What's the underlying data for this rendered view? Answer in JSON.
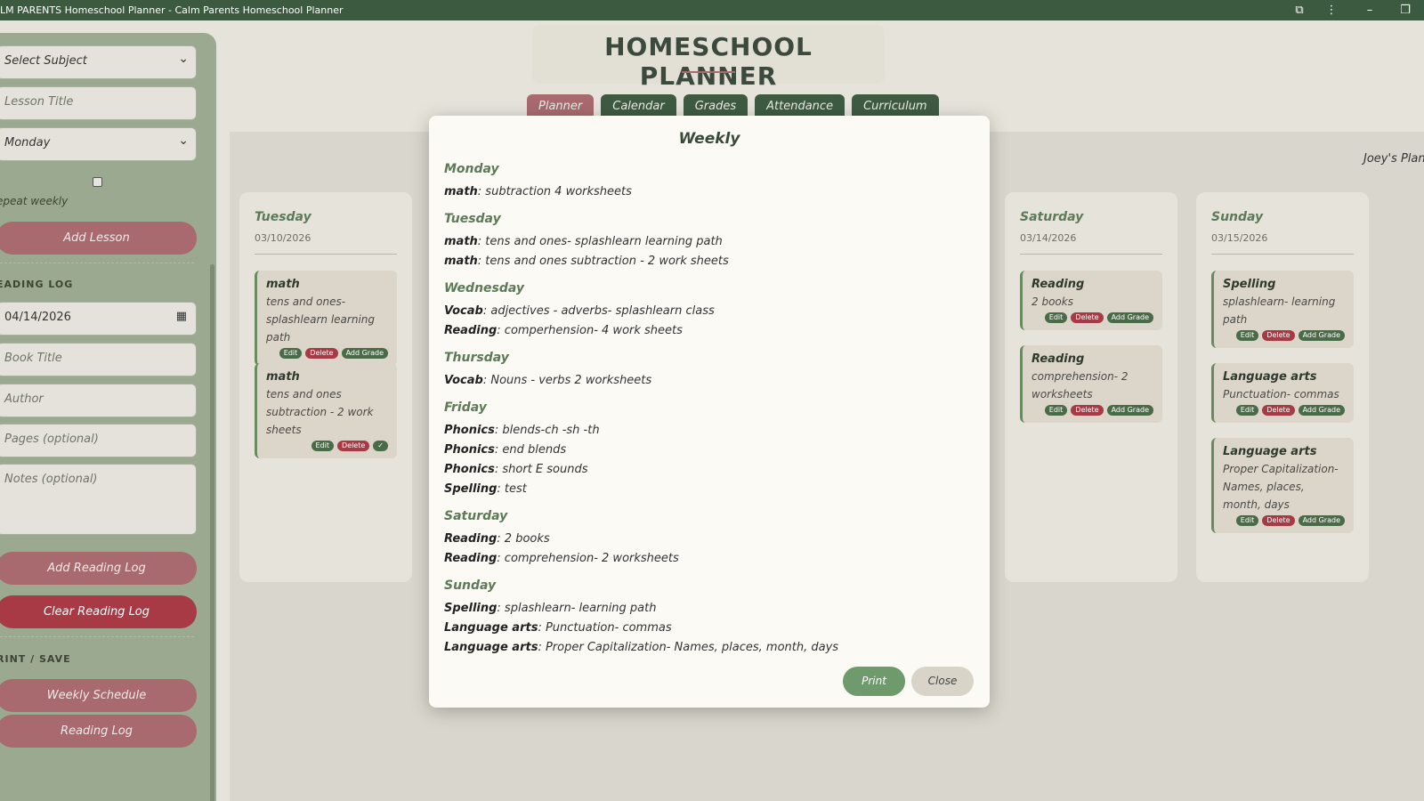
{
  "window": {
    "title": "LM PARENTS Homeschool Planner - Calm Parents Homeschool Planner"
  },
  "sidebar": {
    "subject_select": "Select Subject",
    "lesson_title_placeholder": "Lesson Title",
    "day_select": "Monday",
    "repeat_label": "epeat weekly",
    "add_lesson": "Add Lesson",
    "reading_log_heading": "EADING LOG",
    "reading_date": "04/14/2026",
    "book_title_placeholder": "Book Title",
    "author_placeholder": "Author",
    "pages_placeholder": "Pages (optional)",
    "notes_placeholder": "Notes (optional)",
    "add_reading_log": "Add Reading Log",
    "clear_reading_log": "Clear Reading Log",
    "print_heading": "RINT / SAVE",
    "weekly_schedule": "Weekly Schedule",
    "reading_log": "Reading Log"
  },
  "header": {
    "title": "HOMESCHOOL PLANNER",
    "tabs": [
      "Planner",
      "Calendar",
      "Grades",
      "Attendance",
      "Curriculum"
    ],
    "active_tab": "Planner",
    "planner_name": "Joey's Plann"
  },
  "days": [
    {
      "name": "Tuesday",
      "date": "03/10/2026",
      "lessons": [
        {
          "subject": "math",
          "text": "tens and ones- splashlearn learning path",
          "buttons": [
            "Edit",
            "Delete",
            "Add Grade"
          ]
        },
        {
          "subject": "math",
          "text": "tens and ones subtraction - 2 work sheets",
          "buttons": [
            "Edit",
            "Delete",
            "✓"
          ]
        }
      ]
    },
    {
      "name": "Saturday",
      "date": "03/14/2026",
      "lessons": [
        {
          "subject": "Reading",
          "text": "2 books",
          "buttons": [
            "Edit",
            "Delete",
            "Add Grade"
          ]
        },
        {
          "subject": "Reading",
          "text": "comprehension- 2 worksheets",
          "buttons": [
            "Edit",
            "Delete",
            "Add Grade"
          ]
        }
      ]
    },
    {
      "name": "Sunday",
      "date": "03/15/2026",
      "lessons": [
        {
          "subject": "Spelling",
          "text": "splashlearn- learning path",
          "buttons": [
            "Edit",
            "Delete",
            "Add Grade"
          ]
        },
        {
          "subject": "Language arts",
          "text": "Punctuation- commas",
          "buttons": [
            "Edit",
            "Delete",
            "Add Grade"
          ]
        },
        {
          "subject": "Language arts",
          "text": "Proper Capitalization- Names, places, month, days",
          "buttons": [
            "Edit",
            "Delete",
            "Add Grade"
          ]
        }
      ]
    }
  ],
  "modal": {
    "title": "Weekly",
    "days": [
      {
        "day": "Monday",
        "items": [
          {
            "subject": "math",
            "text": ": subtraction 4 worksheets"
          }
        ]
      },
      {
        "day": "Tuesday",
        "items": [
          {
            "subject": "math",
            "text": ": tens and ones- splashlearn learning path"
          },
          {
            "subject": "math",
            "text": ": tens and ones subtraction - 2 work sheets"
          }
        ]
      },
      {
        "day": "Wednesday",
        "items": [
          {
            "subject": "Vocab",
            "text": ": adjectives - adverbs- splashlearn class"
          },
          {
            "subject": "Reading",
            "text": ": comperhension- 4 work sheets"
          }
        ]
      },
      {
        "day": "Thursday",
        "items": [
          {
            "subject": "Vocab",
            "text": ": Nouns - verbs 2 worksheets"
          }
        ]
      },
      {
        "day": "Friday",
        "items": [
          {
            "subject": "Phonics",
            "text": ": blends-ch -sh -th"
          },
          {
            "subject": "Phonics",
            "text": ": end blends"
          },
          {
            "subject": "Phonics",
            "text": ": short E sounds"
          },
          {
            "subject": "Spelling",
            "text": ": test"
          }
        ]
      },
      {
        "day": "Saturday",
        "items": [
          {
            "subject": "Reading",
            "text": ": 2 books"
          },
          {
            "subject": "Reading",
            "text": ": comprehension- 2 worksheets"
          }
        ]
      },
      {
        "day": "Sunday",
        "items": [
          {
            "subject": "Spelling",
            "text": ": splashlearn- learning path"
          },
          {
            "subject": "Language arts",
            "text": ": Punctuation- commas"
          },
          {
            "subject": "Language arts",
            "text": ": Proper Capitalization- Names, places, month, days"
          }
        ]
      }
    ],
    "print": "Print",
    "close": "Close"
  }
}
